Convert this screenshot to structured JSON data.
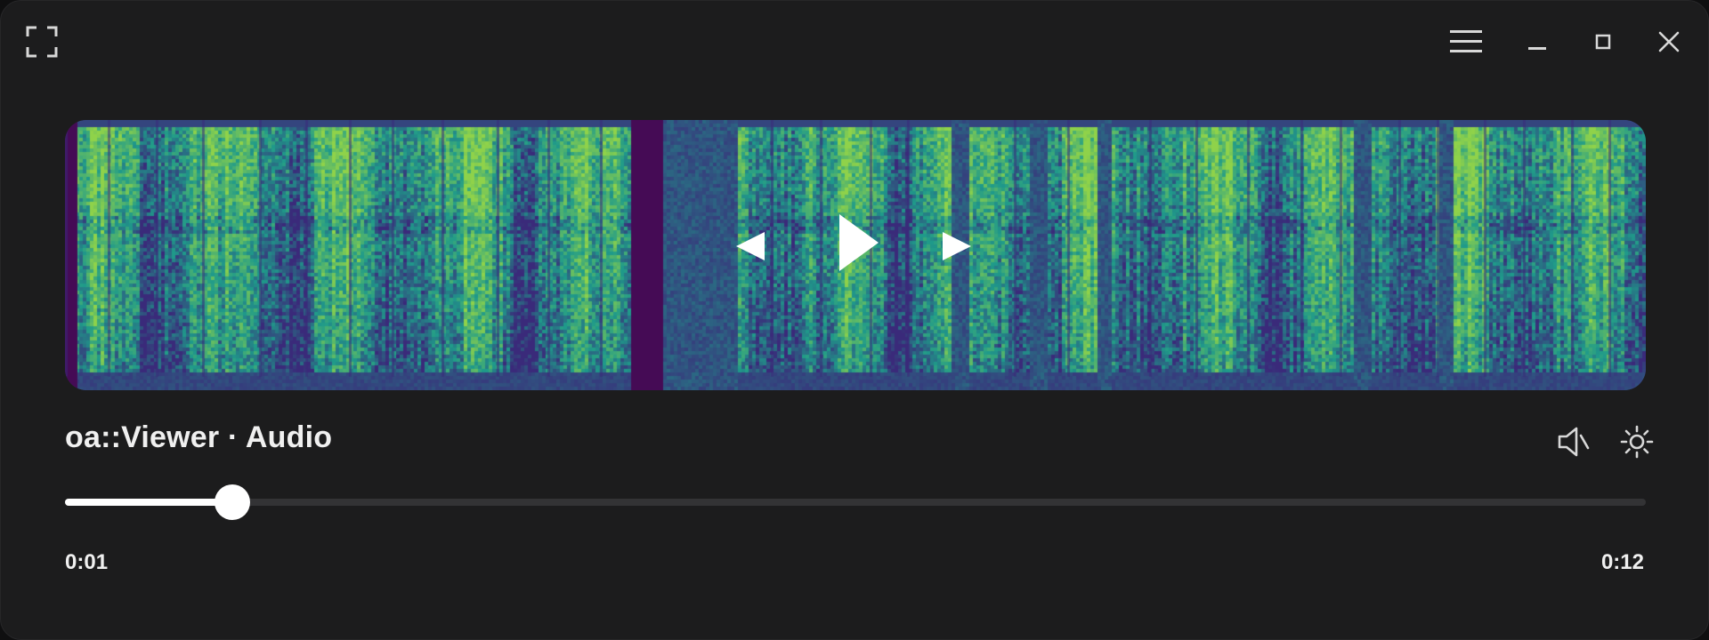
{
  "window": {
    "controls": {
      "fullscreen_icon": "fullscreen-icon",
      "menu_icon": "hamburger-menu-icon",
      "minimize_icon": "minimize-icon",
      "maximize_icon": "maximize-icon",
      "close_icon": "close-icon"
    }
  },
  "player": {
    "title": "oa::Viewer · Audio",
    "current_time": "0:01",
    "duration": "0:12",
    "progress_fraction": 0.106,
    "controls": {
      "previous_icon": "previous-icon",
      "play_icon": "play-icon",
      "next_icon": "next-icon",
      "volume_icon": "volume-icon",
      "brightness_icon": "brightness-icon"
    }
  },
  "colors": {
    "window_bg": "#1c1c1d",
    "accent": "#ffffff",
    "track": "#333335",
    "spectrogram_low": "#3a2a7a",
    "spectrogram_mid": "#1f9a8a",
    "spectrogram_high": "#8fd24a",
    "silence": "#450b55"
  }
}
